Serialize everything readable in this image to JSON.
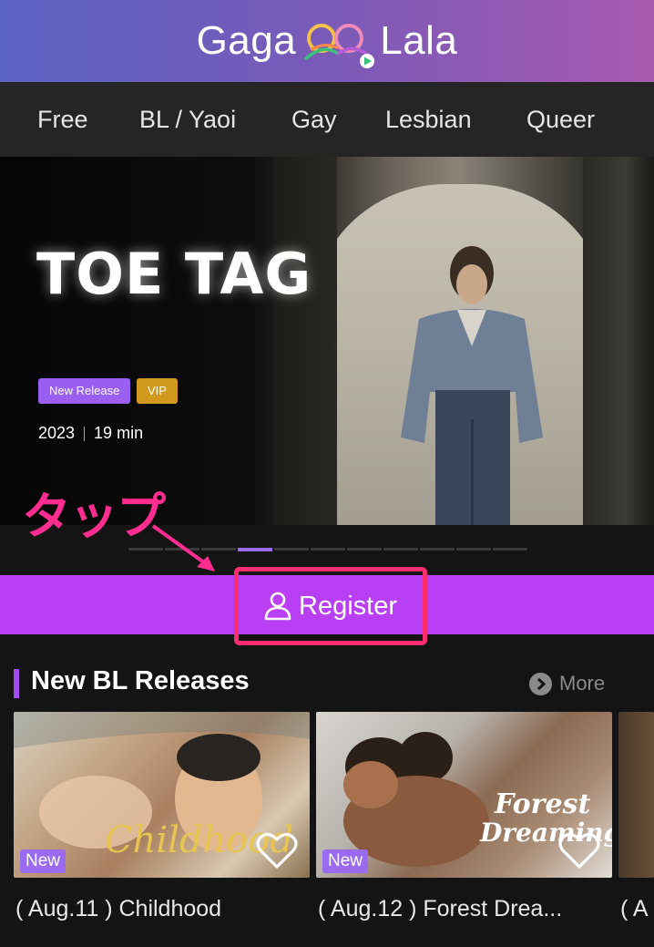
{
  "header": {
    "logo_left": "Gaga",
    "logo_right": "Lala"
  },
  "nav": {
    "items": [
      "Free",
      "BL / Yaoi",
      "Gay",
      "Lesbian",
      "Queer"
    ]
  },
  "hero": {
    "title": "TOE TAG",
    "badges": [
      "New Release",
      "VIP"
    ],
    "year": "2023",
    "duration": "19 min",
    "pager": {
      "total": 11,
      "active_index": 3
    }
  },
  "annotation": {
    "tap_label": "タップ",
    "color": "#ff2d8f"
  },
  "register": {
    "label": "Register",
    "bar_color": "#b93ff4"
  },
  "section": {
    "title": "New BL Releases",
    "more_label": "More",
    "cards": [
      {
        "tag": "New",
        "art_text": "Childhood",
        "caption": "( Aug.11 ) Childhood"
      },
      {
        "tag": "New",
        "art_text_line1": "Forest",
        "art_text_line2": "Dreaming",
        "caption": "( Aug.12 ) Forest Drea..."
      },
      {
        "caption": "( A"
      }
    ]
  },
  "icons": [
    "play-icon",
    "user-icon",
    "chevron-right-icon",
    "heart-icon"
  ]
}
